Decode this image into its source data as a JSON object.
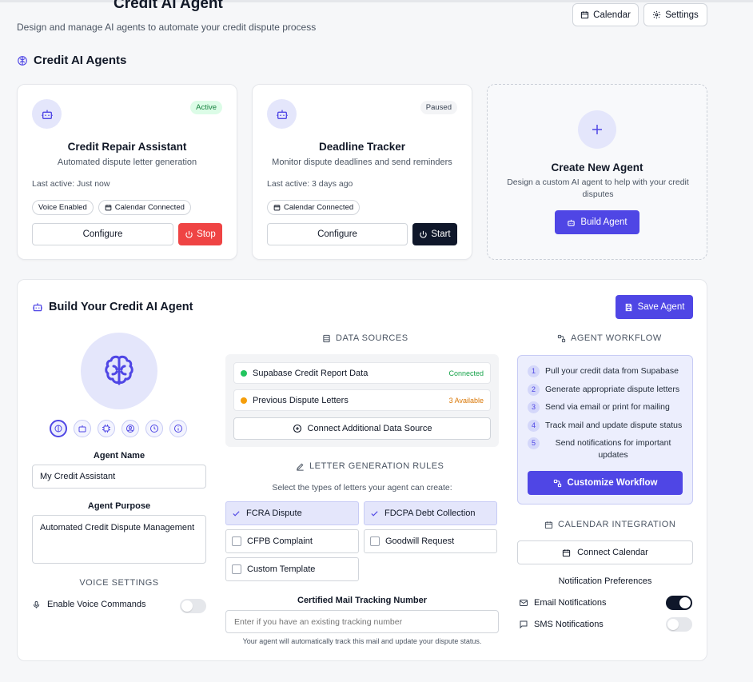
{
  "header": {
    "title": "Credit AI Agent",
    "subtitle": "Design and manage AI agents to automate your credit dispute process",
    "calendar_label": "Calendar",
    "settings_label": "Settings"
  },
  "agents_section": {
    "title": "Credit AI Agents"
  },
  "agents": [
    {
      "name": "Credit Repair Assistant",
      "description": "Automated dispute letter generation",
      "status": "Active",
      "last_active": "Last active: Just now",
      "chips": [
        "Voice Enabled",
        "Calendar Connected"
      ],
      "configure_label": "Configure",
      "action_label": "Stop"
    },
    {
      "name": "Deadline Tracker",
      "description": "Monitor dispute deadlines and send reminders",
      "status": "Paused",
      "last_active": "Last active: 3 days ago",
      "chips": [
        "Calendar Connected"
      ],
      "configure_label": "Configure",
      "action_label": "Start"
    }
  ],
  "create_card": {
    "title": "Create New Agent",
    "description": "Design a custom AI agent to help with your credit disputes",
    "button_label": "Build Agent"
  },
  "builder": {
    "title": "Build Your Credit AI Agent",
    "save_label": "Save Agent",
    "icon_options": [
      "brain-icon",
      "bot-icon",
      "cpu-icon",
      "user-circle-icon",
      "clock-icon",
      "info-icon"
    ],
    "agent_name_label": "Agent Name",
    "agent_name_value": "My Credit Assistant",
    "agent_purpose_label": "Agent Purpose",
    "agent_purpose_value": "Automated Credit Dispute Management",
    "voice_settings_label": "VOICE SETTINGS",
    "enable_voice_label": "Enable Voice Commands",
    "enable_voice_on": false
  },
  "data_sources": {
    "title": "DATA SOURCES",
    "items": [
      {
        "name": "Supabase Credit Report Data",
        "status": "Connected",
        "dot_color": "#22c55e",
        "status_color": "#16a34a"
      },
      {
        "name": "Previous Dispute Letters",
        "status": "3 Available",
        "dot_color": "#f59e0b",
        "status_color": "#d97706"
      }
    ],
    "connect_label": "Connect Additional Data Source"
  },
  "letter_rules": {
    "title": "LETTER GENERATION RULES",
    "subtitle": "Select the types of letters your agent can create:",
    "options": [
      {
        "label": "FCRA Dispute",
        "checked": true
      },
      {
        "label": "FDCPA Debt Collection",
        "checked": true
      },
      {
        "label": "CFPB Complaint",
        "checked": false
      },
      {
        "label": "Goodwill Request",
        "checked": false
      },
      {
        "label": "Custom Template",
        "checked": false
      }
    ],
    "tracking_label": "Certified Mail Tracking Number",
    "tracking_placeholder": "Enter if you have an existing tracking number",
    "tracking_note": "Your agent will automatically track this mail and update your dispute status."
  },
  "workflow": {
    "title": "AGENT WORKFLOW",
    "steps": [
      {
        "num": "1",
        "text": "Pull your credit data from Supabase"
      },
      {
        "num": "2",
        "text": "Generate appropriate dispute letters"
      },
      {
        "num": "3",
        "text": "Send via email or print for mailing"
      },
      {
        "num": "4",
        "text": "Track mail and update dispute status"
      },
      {
        "num": "5",
        "text": "Send notifications for important updates"
      }
    ],
    "customize_label": "Customize Workflow"
  },
  "calendar_integration": {
    "title": "CALENDAR INTEGRATION",
    "connect_label": "Connect Calendar",
    "notif_title": "Notification Preferences",
    "email_label": "Email Notifications",
    "email_on": true,
    "sms_label": "SMS Notifications",
    "sms_on": false
  },
  "colors": {
    "accent": "#4f46e5",
    "accent_light": "#e4e6fb",
    "danger": "#ef4444",
    "dark": "#0f172a"
  }
}
